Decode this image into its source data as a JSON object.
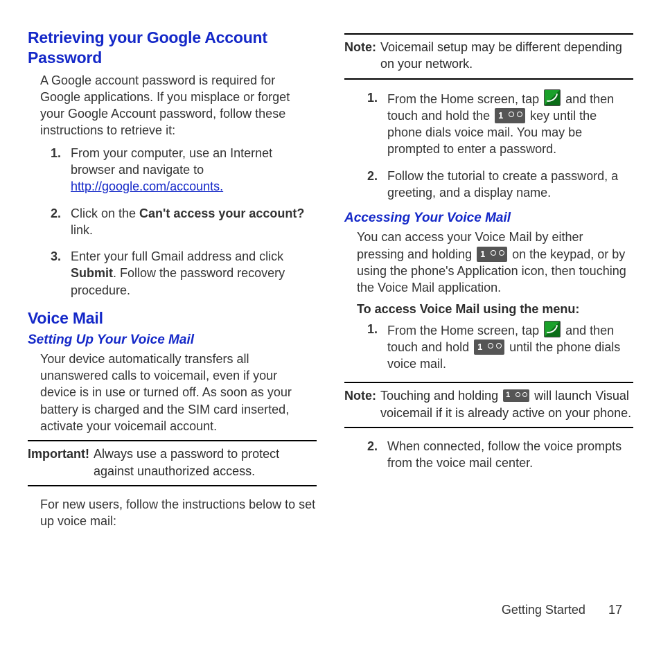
{
  "left": {
    "h1": "Retrieving your Google Account Password",
    "intro": "A Google account password is required for Google applications. If you misplace or forget your Google Account password, follow these instructions to retrieve it:",
    "steps": [
      {
        "num": "1.",
        "pre": "From your computer, use an Internet browser and navigate to ",
        "link": "http://google.com/accounts."
      },
      {
        "num": "2.",
        "pre": "Click on the ",
        "bold": "Can't access your account?",
        "post": " link."
      },
      {
        "num": "3.",
        "pre": "Enter your full Gmail address and click ",
        "bold": "Submit",
        "post": ". Follow the password recovery procedure."
      }
    ],
    "h2": "Voice Mail",
    "sub1": "Setting Up Your Voice Mail",
    "p1": "Your device automatically transfers all unanswered calls to voicemail, even if your device is in use or turned off. As soon as your battery is charged and the SIM card inserted, activate your voicemail account.",
    "imp_label": "Important!",
    "imp_text": " Always use a password to protect against unauthorized access.",
    "p2": "For new users, follow the instructions below to set up voice mail:"
  },
  "right": {
    "note1_label": "Note:",
    "note1_text": " Voicemail setup may be different depending on your network.",
    "steps1": [
      {
        "num": "1.",
        "a": "From the Home screen, tap ",
        "b": " and then touch and hold the ",
        "c": " key until the phone dials voice mail. You may be prompted to enter a password."
      },
      {
        "num": "2.",
        "a": "Follow the tutorial to create a password, a greeting, and a display name."
      }
    ],
    "sub2": "Accessing Your Voice Mail",
    "p3a": "You can access your Voice Mail by either pressing and holding ",
    "p3b": " on the keypad, or by using the phone's Application icon, then touching the Voice Mail application.",
    "menu_head": "To access Voice Mail using the menu:",
    "steps2a": [
      {
        "num": "1.",
        "a": "From the Home screen, tap ",
        "b": " and then touch and hold ",
        "c": " until the phone dials voice mail."
      }
    ],
    "note2_label": "Note:",
    "note2_a": " Touching and holding ",
    "note2_b": " will launch Visual voicemail if it is already active on your phone.",
    "steps2b": [
      {
        "num": "2.",
        "a": "When connected, follow the voice prompts from the voice mail center."
      }
    ]
  },
  "footer": {
    "section": "Getting Started",
    "page": "17"
  }
}
